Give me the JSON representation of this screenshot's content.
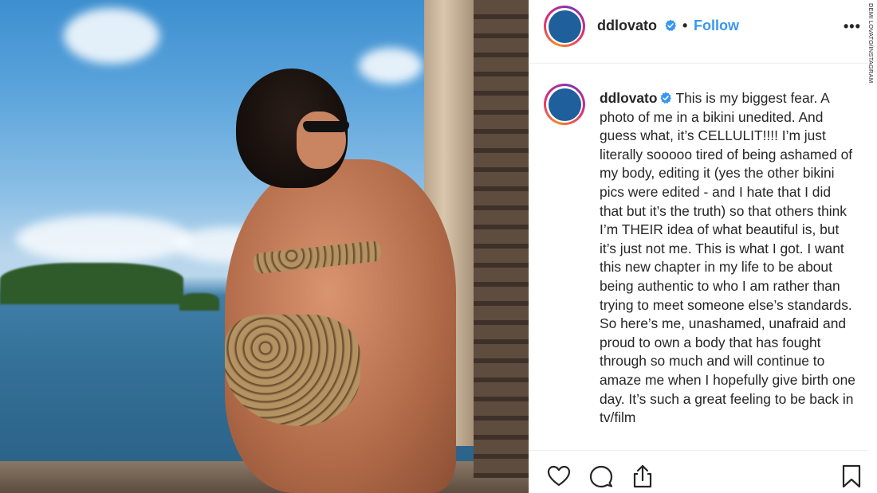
{
  "post": {
    "username": "ddlovato",
    "follow_label": "Follow",
    "separator": "•",
    "more_label": "•••",
    "caption": "This is my biggest fear. A photo of me in a bikini unedited. And guess what, it’s CELLULIT!!!! I’m just literally sooooo tired of being ashamed of my body, editing it (yes the other bikini pics were edited - and I hate that I did that but it’s the truth) so that others think I’m THEIR idea of what beautiful is, but it’s just not me. This is what I got. I want this new chapter in my life to be about being authentic to who I am rather than trying to meet someone else’s standards. So here’s me, unashamed, unafraid and proud to own a body that has fought through so much and will continue to amaze me when I hopefully give birth one day. It’s such a great feeling to be back in tv/film"
  },
  "credit": "DEMI LOVATO/INSTAGRAM",
  "icons": {
    "verified": "verified-badge-icon",
    "like": "heart-icon",
    "comment": "comment-bubble-icon",
    "share": "share-icon",
    "save": "bookmark-icon"
  },
  "colors": {
    "accent": "#3897f0",
    "verified": "#3897f0",
    "avatar_fill": "#1f5f9c",
    "text": "#262626",
    "border": "#efefef"
  }
}
